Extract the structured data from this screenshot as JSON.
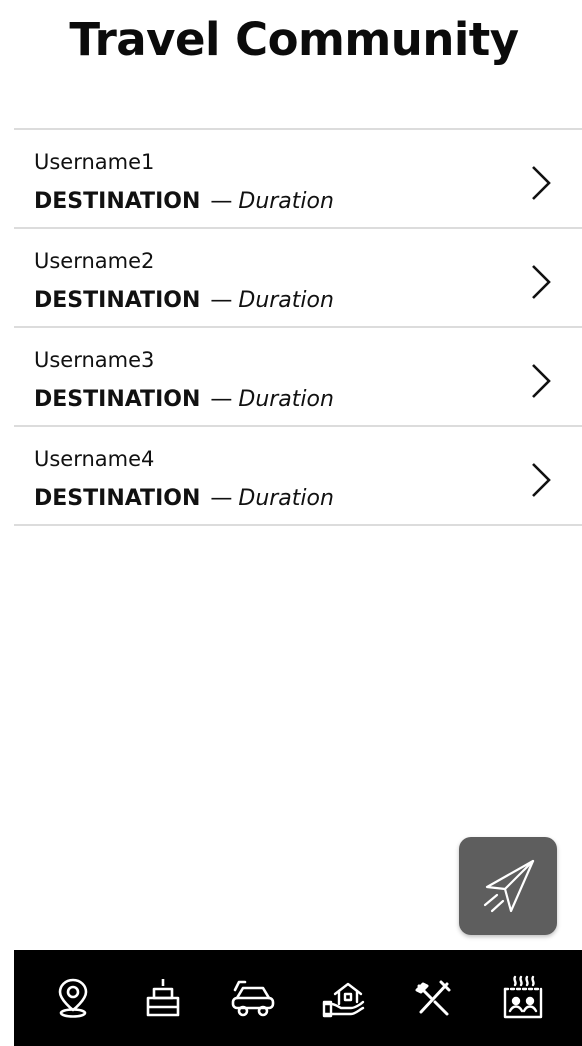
{
  "header": {
    "title": "Travel Community"
  },
  "posts": [
    {
      "username": "Username1",
      "destination": "DESTINATION",
      "separator": "—",
      "duration": "Duration"
    },
    {
      "username": "Username2",
      "destination": "DESTINATION",
      "separator": "—",
      "duration": "Duration"
    },
    {
      "username": "Username3",
      "destination": "DESTINATION",
      "separator": "—",
      "duration": "Duration"
    },
    {
      "username": "Username4",
      "destination": "DESTINATION",
      "separator": "—",
      "duration": "Duration"
    }
  ],
  "fab": {
    "icon": "paper-plane-icon"
  },
  "bottom_nav": {
    "items": [
      {
        "icon": "map-pin-icon"
      },
      {
        "icon": "cake-icon"
      },
      {
        "icon": "car-icon"
      },
      {
        "icon": "house-hand-icon"
      },
      {
        "icon": "tools-icon"
      },
      {
        "icon": "hot-spring-icon"
      }
    ]
  },
  "colors": {
    "background": "#ffffff",
    "divider": "#dcdcdc",
    "fab": "#5e5e5e",
    "nav_bar": "#000000",
    "nav_icon": "#ffffff",
    "text": "#111111"
  }
}
